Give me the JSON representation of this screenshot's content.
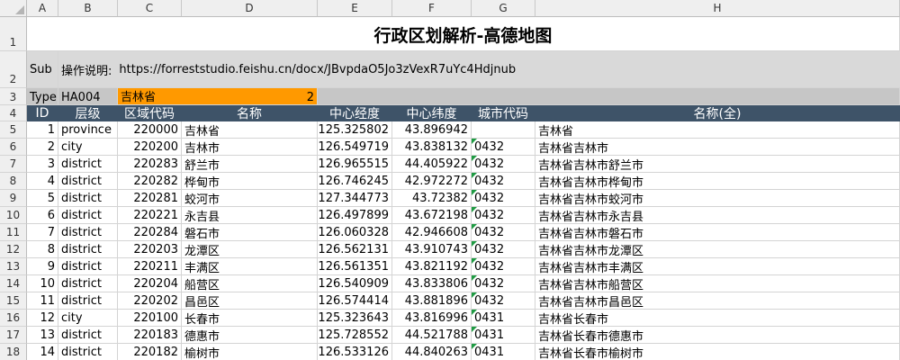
{
  "columns": [
    "A",
    "B",
    "C",
    "D",
    "E",
    "F",
    "G",
    "H"
  ],
  "row_numbers": [
    "1",
    "2",
    "3",
    "4",
    "5",
    "6",
    "7",
    "8",
    "9",
    "10",
    "11",
    "12",
    "13",
    "14",
    "15",
    "16",
    "17",
    "18"
  ],
  "title": "行政区划解析-高德地图",
  "row2": {
    "a": "Sub",
    "instruction_label": "操作说明:",
    "instruction_url": "https://forreststudio.feishu.cn/docx/JBvpdaO5Jo3zVexR7uYc4Hdjnub"
  },
  "row3": {
    "a": "TypeID",
    "b": "HA004",
    "c": "吉林省",
    "d": "2"
  },
  "headers": {
    "id": "ID",
    "level": "层级",
    "code": "区域代码",
    "name": "名称",
    "lng": "中心经度",
    "lat": "中心纬度",
    "city_code": "城市代码",
    "full_name": "名称(全)"
  },
  "rows": [
    {
      "id": "1",
      "level": "province",
      "code": "220000",
      "name": "吉林省",
      "lng": "125.325802",
      "lat": "43.896942",
      "city_code": "",
      "full_name": "吉林省"
    },
    {
      "id": "2",
      "level": "city",
      "code": "220200",
      "name": "吉林市",
      "lng": "126.549719",
      "lat": "43.838132",
      "city_code": "0432",
      "full_name": "吉林省吉林市"
    },
    {
      "id": "3",
      "level": "district",
      "code": "220283",
      "name": "舒兰市",
      "lng": "126.965515",
      "lat": "44.405922",
      "city_code": "0432",
      "full_name": "吉林省吉林市舒兰市"
    },
    {
      "id": "4",
      "level": "district",
      "code": "220282",
      "name": "桦甸市",
      "lng": "126.746245",
      "lat": "42.972272",
      "city_code": "0432",
      "full_name": "吉林省吉林市桦甸市"
    },
    {
      "id": "5",
      "level": "district",
      "code": "220281",
      "name": "蛟河市",
      "lng": "127.344773",
      "lat": "43.72382",
      "city_code": "0432",
      "full_name": "吉林省吉林市蛟河市"
    },
    {
      "id": "6",
      "level": "district",
      "code": "220221",
      "name": "永吉县",
      "lng": "126.497899",
      "lat": "43.672198",
      "city_code": "0432",
      "full_name": "吉林省吉林市永吉县"
    },
    {
      "id": "7",
      "level": "district",
      "code": "220284",
      "name": "磐石市",
      "lng": "126.060328",
      "lat": "42.946608",
      "city_code": "0432",
      "full_name": "吉林省吉林市磐石市"
    },
    {
      "id": "8",
      "level": "district",
      "code": "220203",
      "name": "龙潭区",
      "lng": "126.562131",
      "lat": "43.910743",
      "city_code": "0432",
      "full_name": "吉林省吉林市龙潭区"
    },
    {
      "id": "9",
      "level": "district",
      "code": "220211",
      "name": "丰满区",
      "lng": "126.561351",
      "lat": "43.821192",
      "city_code": "0432",
      "full_name": "吉林省吉林市丰满区"
    },
    {
      "id": "10",
      "level": "district",
      "code": "220204",
      "name": "船营区",
      "lng": "126.540909",
      "lat": "43.833806",
      "city_code": "0432",
      "full_name": "吉林省吉林市船营区"
    },
    {
      "id": "11",
      "level": "district",
      "code": "220202",
      "name": "昌邑区",
      "lng": "126.574414",
      "lat": "43.881896",
      "city_code": "0432",
      "full_name": "吉林省吉林市昌邑区"
    },
    {
      "id": "12",
      "level": "city",
      "code": "220100",
      "name": "长春市",
      "lng": "125.323643",
      "lat": "43.816996",
      "city_code": "0431",
      "full_name": "吉林省长春市"
    },
    {
      "id": "13",
      "level": "district",
      "code": "220183",
      "name": "德惠市",
      "lng": "125.728552",
      "lat": "44.521788",
      "city_code": "0431",
      "full_name": "吉林省长春市德惠市"
    },
    {
      "id": "14",
      "level": "district",
      "code": "220182",
      "name": "榆树市",
      "lng": "126.533126",
      "lat": "44.840263",
      "city_code": "0431",
      "full_name": "吉林省长春市榆树市"
    }
  ]
}
